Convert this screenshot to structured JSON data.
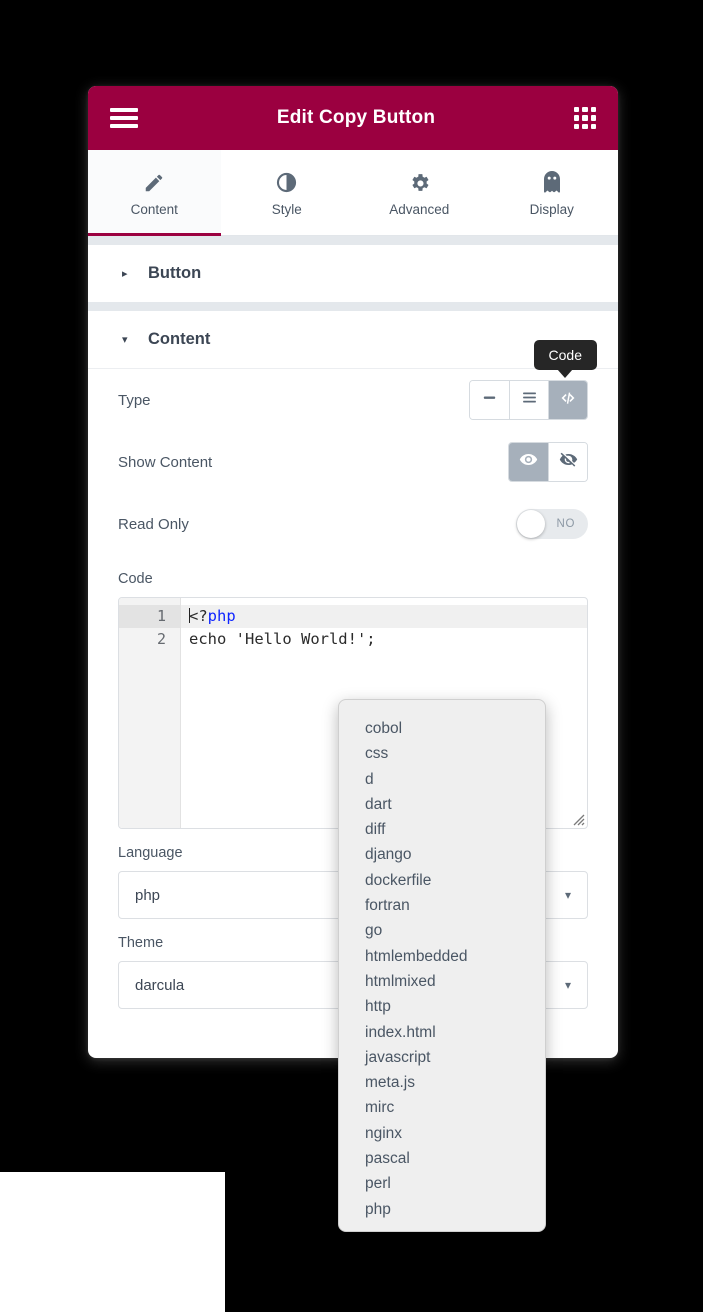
{
  "colors": {
    "brand": "#9b0040",
    "accent_active": "#a6b0bb",
    "text": "#4a5664",
    "code_keyword": "#0f25ff"
  },
  "header": {
    "title": "Edit Copy Button",
    "menu_icon": "hamburger-icon",
    "grid_icon": "grid-icon"
  },
  "tabs": [
    {
      "label": "Content",
      "icon": "pencil-icon",
      "active": true
    },
    {
      "label": "Style",
      "icon": "contrast-icon",
      "active": false
    },
    {
      "label": "Advanced",
      "icon": "gear-icon",
      "active": false
    },
    {
      "label": "Display",
      "icon": "ghost-icon",
      "active": false
    }
  ],
  "sections": [
    {
      "title": "Button",
      "caret": "▸",
      "expanded": false
    },
    {
      "title": "Content",
      "caret": "▾",
      "expanded": true
    }
  ],
  "content": {
    "type": {
      "label": "Type",
      "tooltip": "Code",
      "options": [
        {
          "name": "inline",
          "icon": "minus-icon",
          "active": false
        },
        {
          "name": "block",
          "icon": "lines-icon",
          "active": false
        },
        {
          "name": "code",
          "icon": "code-icon",
          "active": true
        }
      ]
    },
    "show_content": {
      "label": "Show Content",
      "options": [
        {
          "name": "show",
          "icon": "eye-icon",
          "active": true
        },
        {
          "name": "hide",
          "icon": "eye-slash-icon",
          "active": false
        }
      ]
    },
    "read_only": {
      "label": "Read Only",
      "state": "NO",
      "on": false
    },
    "code": {
      "label": "Code",
      "line_numbers": [
        "1",
        "2"
      ],
      "lines": [
        {
          "prefix": "<?",
          "keyword": "php",
          "suffix": "",
          "current": true
        },
        {
          "prefix": "echo 'Hello World!';",
          "keyword": "",
          "suffix": "",
          "current": false
        }
      ]
    },
    "language": {
      "label": "Language",
      "value": "php",
      "chevron": "▾"
    },
    "theme": {
      "label": "Theme",
      "value": "darcula",
      "chevron": "▾"
    }
  },
  "dropdown": {
    "options": [
      "cobol",
      "css",
      "d",
      "dart",
      "diff",
      "django",
      "dockerfile",
      "fortran",
      "go",
      "htmlembedded",
      "htmlmixed",
      "http",
      "index.html",
      "javascript",
      "meta.js",
      "mirc",
      "nginx",
      "pascal",
      "perl",
      "php"
    ]
  }
}
